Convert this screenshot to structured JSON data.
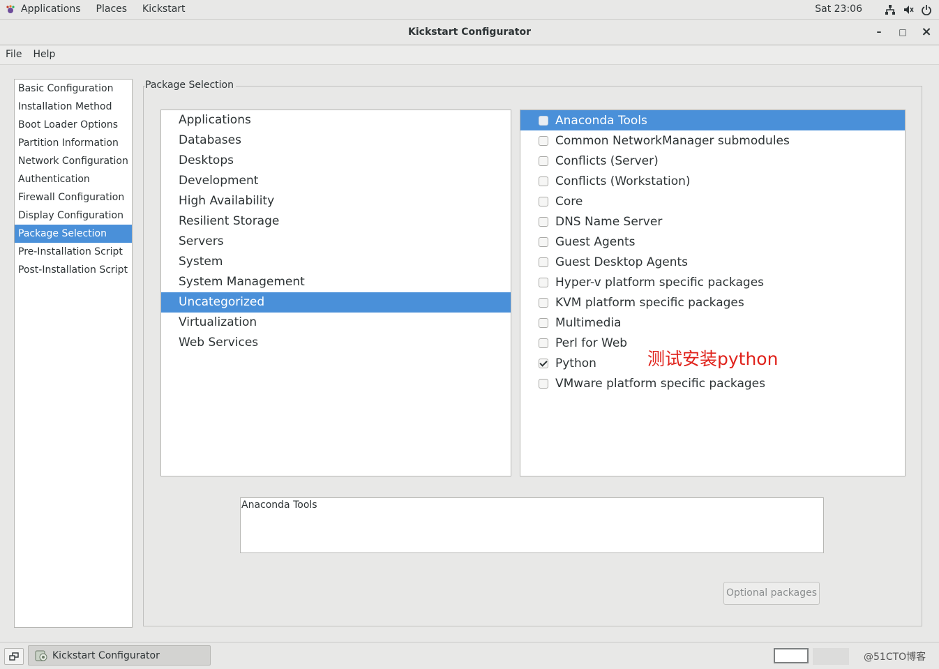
{
  "top_panel": {
    "applications": "Applications",
    "places": "Places",
    "kickstart": "Kickstart",
    "clock": "Sat 23:06"
  },
  "window": {
    "title": "Kickstart Configurator",
    "minimize": "–",
    "maximize": "□",
    "close": "×"
  },
  "menubar": {
    "file": "File",
    "help": "Help"
  },
  "sidebar": {
    "items": [
      {
        "label": "Basic Configuration"
      },
      {
        "label": "Installation Method"
      },
      {
        "label": "Boot Loader Options"
      },
      {
        "label": "Partition Information"
      },
      {
        "label": "Network Configuration"
      },
      {
        "label": "Authentication"
      },
      {
        "label": "Firewall Configuration"
      },
      {
        "label": "Display Configuration"
      },
      {
        "label": "Package Selection"
      },
      {
        "label": "Pre-Installation Script"
      },
      {
        "label": "Post-Installation Script"
      }
    ],
    "selected": "Package Selection"
  },
  "package_selection": {
    "frame_label": "Package Selection",
    "categories": [
      {
        "label": "Applications"
      },
      {
        "label": "Databases"
      },
      {
        "label": "Desktops"
      },
      {
        "label": "Development"
      },
      {
        "label": "High Availability"
      },
      {
        "label": "Resilient Storage"
      },
      {
        "label": "Servers"
      },
      {
        "label": "System"
      },
      {
        "label": "System Management"
      },
      {
        "label": "Uncategorized"
      },
      {
        "label": "Virtualization"
      },
      {
        "label": "Web Services"
      }
    ],
    "selected_category": "Uncategorized",
    "groups": [
      {
        "label": "Anaconda Tools",
        "checked": false
      },
      {
        "label": "Common NetworkManager submodules",
        "checked": false
      },
      {
        "label": "Conflicts (Server)",
        "checked": false
      },
      {
        "label": "Conflicts (Workstation)",
        "checked": false
      },
      {
        "label": "Core",
        "checked": false
      },
      {
        "label": "DNS Name Server",
        "checked": false
      },
      {
        "label": "Guest Agents",
        "checked": false
      },
      {
        "label": "Guest Desktop Agents",
        "checked": false
      },
      {
        "label": "Hyper-v platform specific packages",
        "checked": false
      },
      {
        "label": "KVM platform specific packages",
        "checked": false
      },
      {
        "label": "Multimedia",
        "checked": false
      },
      {
        "label": "Perl for Web",
        "checked": false
      },
      {
        "label": "Python",
        "checked": true
      },
      {
        "label": "VMware platform specific packages",
        "checked": false
      }
    ],
    "selected_group": "Anaconda Tools",
    "annotation": "测试安装python",
    "description": "Anaconda Tools",
    "optional_packages_button": "Optional packages"
  },
  "taskbar": {
    "task_label": "Kickstart Configurator",
    "watermark": "@51CTO博客"
  },
  "colors": {
    "selection": "#4a90d9",
    "annotation": "#e0231c"
  }
}
